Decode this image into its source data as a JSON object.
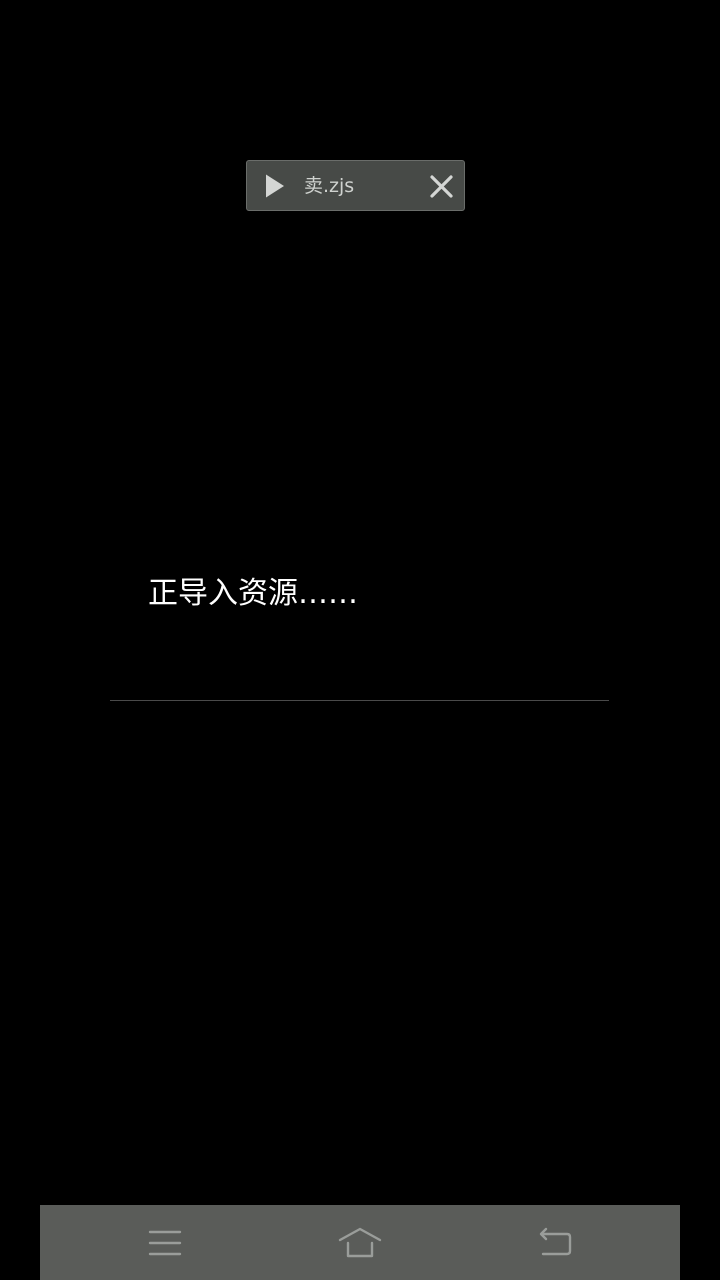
{
  "script_chip": {
    "file_name": "卖.zjs",
    "play_icon": "play-triangle-icon",
    "close_icon": "close-x-icon"
  },
  "loading": {
    "message": "正导入资源……"
  },
  "nav_bar": {
    "menu_icon": "menu-lines-icon",
    "home_icon": "home-icon",
    "back_icon": "back-arrow-icon"
  },
  "colors": {
    "background": "#000000",
    "chip_background": "#474a47",
    "chip_text": "#cfd2cf",
    "nav_background": "#5a5c59",
    "nav_icon": "#9a9d9a"
  }
}
